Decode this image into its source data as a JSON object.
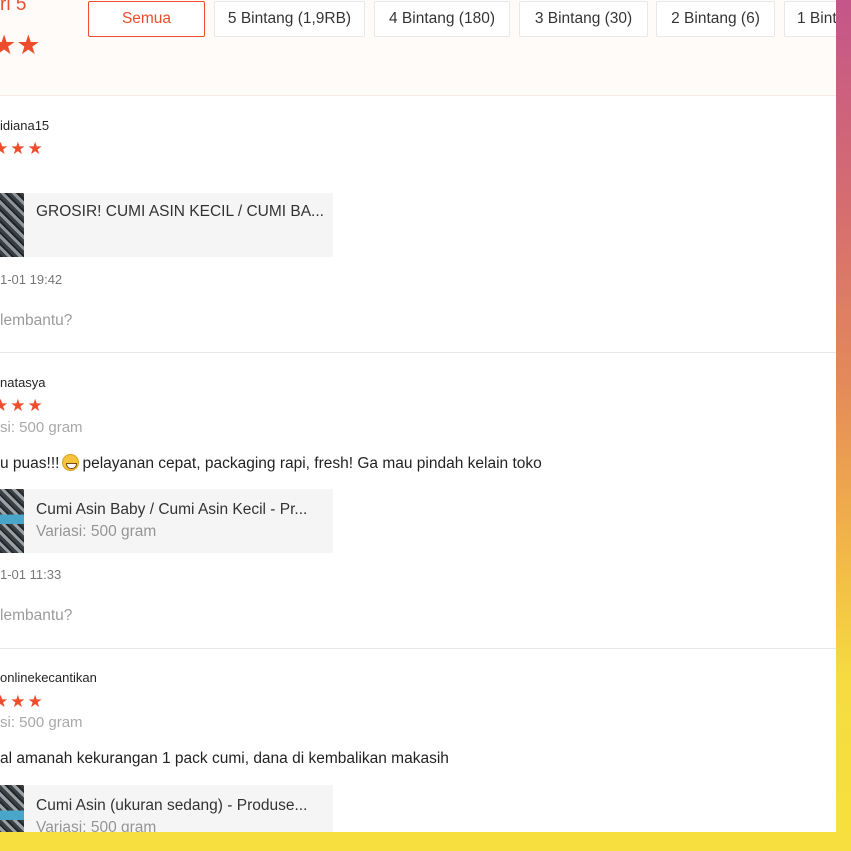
{
  "rating_summary": {
    "score_text": "ri 5",
    "stars": "★★"
  },
  "filters": [
    {
      "label": "Semua",
      "active": true
    },
    {
      "label": "5 Bintang (1,9RB)",
      "active": false
    },
    {
      "label": "4 Bintang (180)",
      "active": false
    },
    {
      "label": "3 Bintang (30)",
      "active": false
    },
    {
      "label": "2 Bintang (6)",
      "active": false
    },
    {
      "label": "1 Bint",
      "active": false
    }
  ],
  "reviews": [
    {
      "username": "idiana15",
      "stars": "★★★",
      "product_name": "GROSIR! CUMI ASIN KECIL / CUMI BA...",
      "timestamp": "1-01 19:42",
      "helpful": "lembantu?"
    },
    {
      "username": "natasya",
      "stars": "★★★",
      "variation": "si: 500 gram",
      "comment_before": "u puas!!!",
      "comment_after": "pelayanan cepat, packaging rapi, fresh! Ga mau pindah kelain toko",
      "product_name": "Cumi Asin Baby / Cumi Asin Kecil - Pr...",
      "product_variation": "Variasi: 500 gram",
      "timestamp": "1-01 11:33",
      "helpful": "lembantu?"
    },
    {
      "username": "onlinekecantikan",
      "stars": "★★★",
      "variation": "si: 500 gram",
      "comment": "al amanah kekurangan 1 pack cumi,  dana di kembalikan makasih",
      "product_name": "Cumi Asin (ukuran sedang) - Produse...",
      "product_variation": "Variasi: 500 gram"
    }
  ],
  "colors": {
    "accent": "#ee4d2d",
    "frame_gradient_top": "#c4568a",
    "frame_yellow": "#f7df3f"
  }
}
